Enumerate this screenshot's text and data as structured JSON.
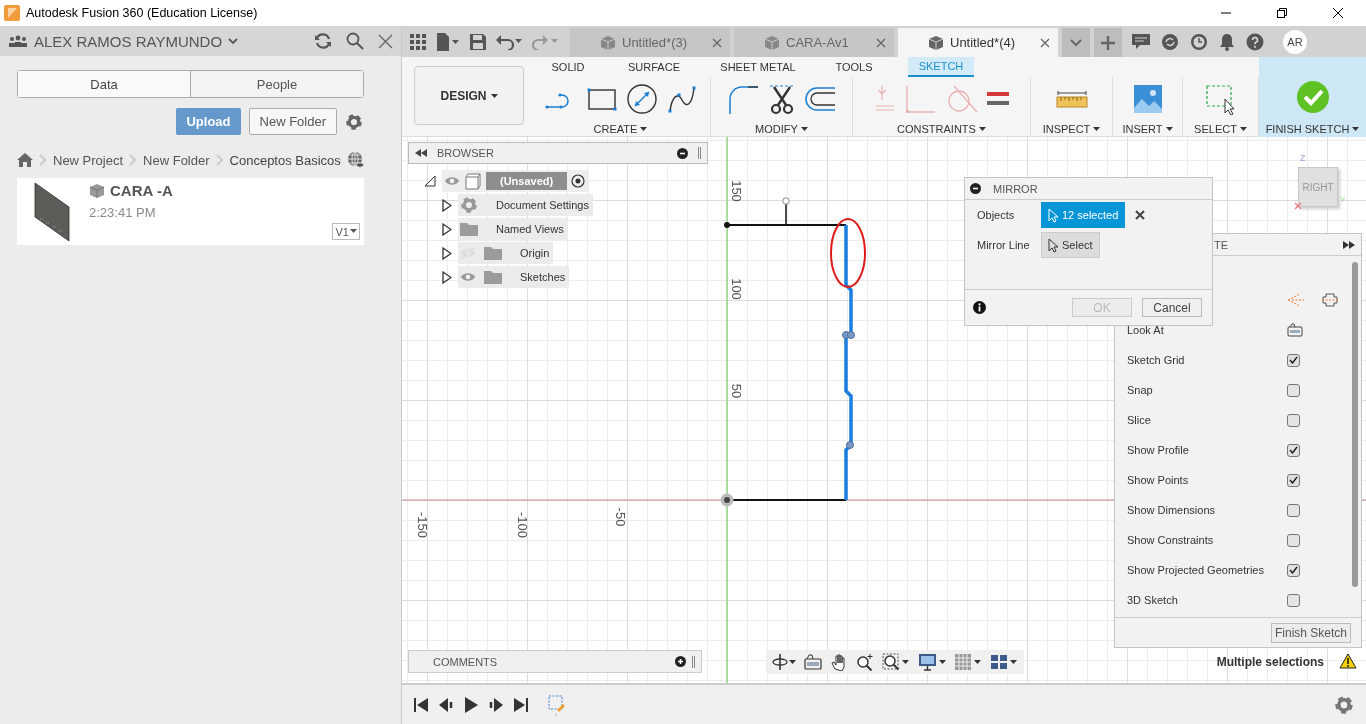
{
  "window": {
    "title": "Autodesk Fusion 360 (Education License)"
  },
  "data_panel": {
    "account": "ALEX RAMOS RAYMUNDO",
    "tabs": [
      {
        "label": "Data",
        "selected": true
      },
      {
        "label": "People",
        "selected": false
      }
    ],
    "buttons": [
      {
        "label": "Upload",
        "kind": "primary"
      },
      {
        "label": "New Folder",
        "kind": "secondary"
      }
    ],
    "breadcrumb": [
      "New Project",
      "New Folder",
      "Conceptos Basicos"
    ],
    "files": [
      {
        "name": "CARA -A",
        "time": "2:23:41 PM",
        "version": "V1"
      }
    ]
  },
  "document_tabs": [
    {
      "label": "Untitled*(3)",
      "selected": false
    },
    {
      "label": "CARA-Av1",
      "selected": false
    },
    {
      "label": "Untitled*(4)",
      "selected": true
    }
  ],
  "user": {
    "initials": "AR"
  },
  "workspace": "DESIGN",
  "ribbon_tabs": [
    {
      "label": "SOLID",
      "selected": false
    },
    {
      "label": "SURFACE",
      "selected": false
    },
    {
      "label": "SHEET METAL",
      "selected": false
    },
    {
      "label": "TOOLS",
      "selected": false
    },
    {
      "label": "SKETCH",
      "selected": true
    }
  ],
  "ribbon_groups": [
    {
      "label": "CREATE",
      "kind": "create"
    },
    {
      "label": "MODIFY",
      "kind": "modify"
    },
    {
      "label": "CONSTRAINTS",
      "kind": "constraints"
    },
    {
      "label": "INSPECT",
      "kind": "inspect"
    },
    {
      "label": "INSERT",
      "kind": "insert"
    },
    {
      "label": "SELECT",
      "kind": "select"
    },
    {
      "label": "FINISH SKETCH",
      "kind": "finish"
    }
  ],
  "browser": {
    "title": "BROWSER",
    "root": {
      "label": "(Unsaved)",
      "expanded": true,
      "visible": true,
      "children": [
        {
          "label": "Document Settings",
          "kind": "settings",
          "expanded": false
        },
        {
          "label": "Named Views",
          "kind": "folder",
          "expanded": false
        },
        {
          "label": "Origin",
          "kind": "folder",
          "expanded": false,
          "visible": false
        },
        {
          "label": "Sketches",
          "kind": "folder",
          "expanded": false,
          "visible": true
        }
      ]
    }
  },
  "canvas": {
    "vertical_ticks": [
      "150",
      "100",
      "50"
    ],
    "horizontal_ticks": [
      "-150",
      "-100",
      "-50"
    ]
  },
  "view_cube": {
    "face": "RIGHT",
    "axes": [
      "Z",
      "Y"
    ]
  },
  "mirror_dialog": {
    "title": "MIRROR",
    "rows": [
      {
        "label": "Objects",
        "value": "12 selected",
        "selected": true
      },
      {
        "label": "Mirror Line",
        "value": "Select",
        "selected": false
      }
    ],
    "buttons": [
      {
        "label": "OK",
        "disabled": true
      },
      {
        "label": "Cancel",
        "disabled": false
      }
    ]
  },
  "sketch_palette": {
    "title": "TE",
    "rows": [
      {
        "kind": "icons"
      },
      {
        "kind": "action",
        "label": "Look At"
      },
      {
        "kind": "checkbox",
        "label": "Sketch Grid",
        "checked": true
      },
      {
        "kind": "checkbox",
        "label": "Snap",
        "checked": false
      },
      {
        "kind": "checkbox",
        "label": "Slice",
        "checked": false
      },
      {
        "kind": "checkbox",
        "label": "Show Profile",
        "checked": true
      },
      {
        "kind": "checkbox",
        "label": "Show Points",
        "checked": true
      },
      {
        "kind": "checkbox",
        "label": "Show Dimensions",
        "checked": false
      },
      {
        "kind": "checkbox",
        "label": "Show Constraints",
        "checked": false
      },
      {
        "kind": "checkbox",
        "label": "Show Projected Geometries",
        "checked": true
      },
      {
        "kind": "checkbox",
        "label": "3D Sketch",
        "checked": false
      }
    ],
    "button": "Finish Sketch"
  },
  "comments": {
    "title": "COMMENTS"
  },
  "status": {
    "message": "Multiple selections",
    "warning": true
  }
}
